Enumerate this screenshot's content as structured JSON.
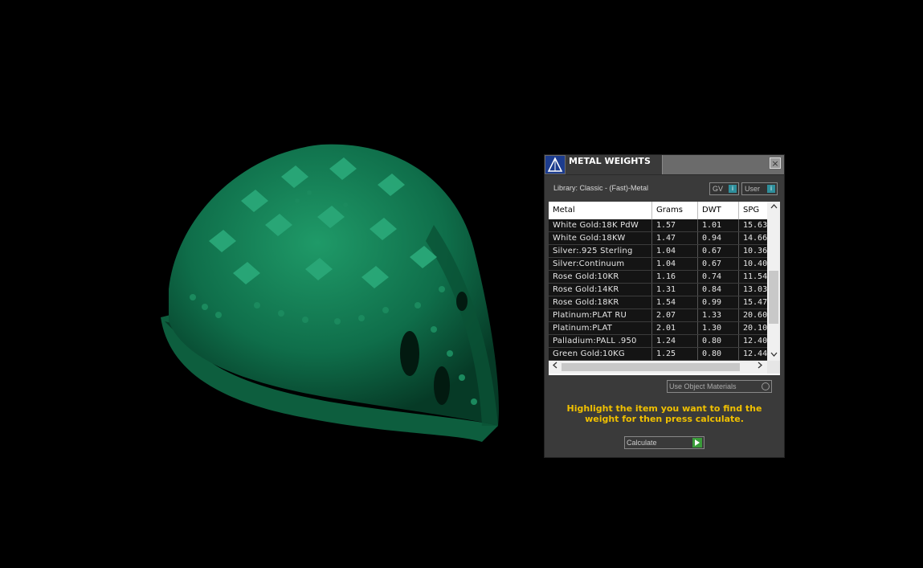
{
  "panel": {
    "title": "METAL WEIGHTS",
    "close_glyph": "×",
    "library_label": "Library: Classic - (Fast)-Metal",
    "gv_label": "GV",
    "user_label": "User",
    "indicator_glyph": "i",
    "use_object_materials_label": "Use Object Materials",
    "hint": "Highlight the item you want to find the weight for then press calculate.",
    "calculate_label": "Calculate"
  },
  "table": {
    "headers": [
      "Metal",
      "Grams",
      "DWT",
      "SPG"
    ],
    "rows": [
      {
        "metal": "White Gold:18K PdW",
        "grams": "1.57",
        "dwt": "1.01",
        "spg": "15.63"
      },
      {
        "metal": "White Gold:18KW",
        "grams": "1.47",
        "dwt": "0.94",
        "spg": "14.66"
      },
      {
        "metal": "Silver:.925 Sterling",
        "grams": "1.04",
        "dwt": "0.67",
        "spg": "10.36"
      },
      {
        "metal": "Silver:Continuum",
        "grams": "1.04",
        "dwt": "0.67",
        "spg": "10.40"
      },
      {
        "metal": "Rose Gold:10KR",
        "grams": "1.16",
        "dwt": "0.74",
        "spg": "11.54"
      },
      {
        "metal": "Rose Gold:14KR",
        "grams": "1.31",
        "dwt": "0.84",
        "spg": "13.03"
      },
      {
        "metal": "Rose Gold:18KR",
        "grams": "1.54",
        "dwt": "0.99",
        "spg": "15.47"
      },
      {
        "metal": "Platinum:PLAT RU",
        "grams": "2.07",
        "dwt": "1.33",
        "spg": "20.60"
      },
      {
        "metal": "Platinum:PLAT",
        "grams": "2.01",
        "dwt": "1.30",
        "spg": "20.10"
      },
      {
        "metal": "Palladium:PALL .950",
        "grams": "1.24",
        "dwt": "0.80",
        "spg": "12.40"
      },
      {
        "metal": "Green Gold:10KG",
        "grams": "1.25",
        "dwt": "0.80",
        "spg": "12.44"
      }
    ]
  },
  "viewport": {
    "model_color": "#0f6e4a"
  }
}
